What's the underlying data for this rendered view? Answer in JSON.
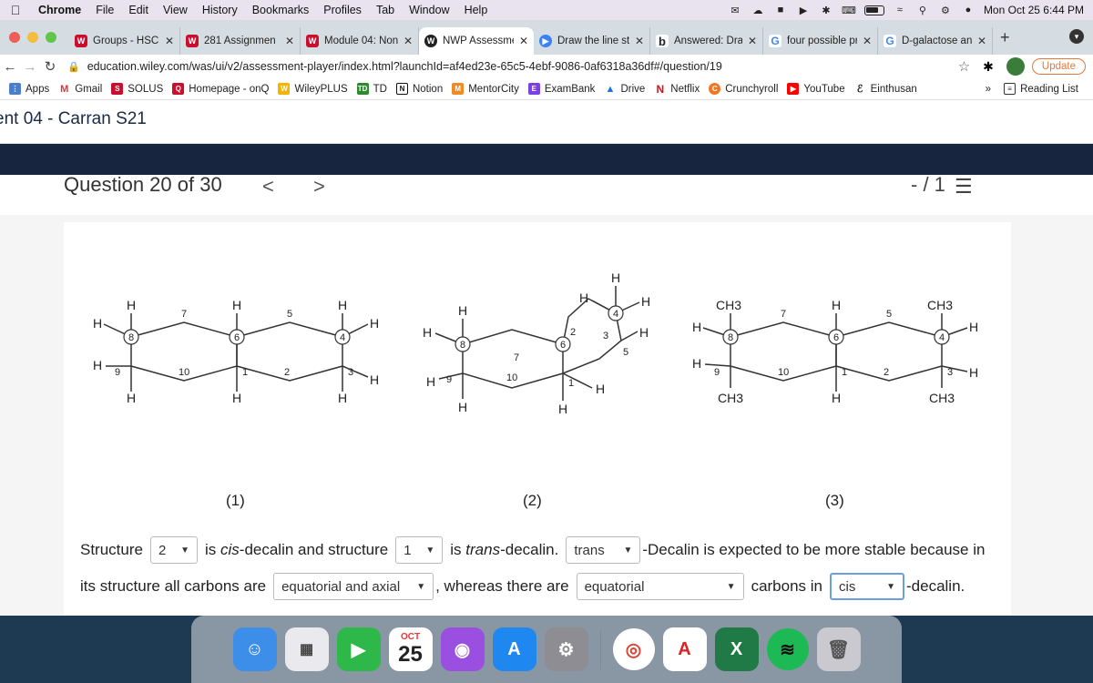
{
  "menubar": {
    "app": "Chrome",
    "items": [
      "File",
      "Edit",
      "View",
      "History",
      "Bookmarks",
      "Profiles",
      "Tab",
      "Window",
      "Help"
    ],
    "clock": "Mon Oct 25  6:44 PM"
  },
  "tabs": [
    {
      "label": "Groups - HSCI",
      "icon": "wiley"
    },
    {
      "label": "281 Assignmen",
      "icon": "wiley"
    },
    {
      "label": "Module 04: Non",
      "icon": "wiley"
    },
    {
      "label": "NWP Assessme",
      "icon": "wiley-active"
    },
    {
      "label": "Draw the line st",
      "icon": "media"
    },
    {
      "label": "Answered: Draw",
      "icon": "bartleby"
    },
    {
      "label": "four possible pr",
      "icon": "google"
    },
    {
      "label": "D-galactose an",
      "icon": "google"
    }
  ],
  "toolbar": {
    "url": "education.wiley.com/was/ui/v2/assessment-player/index.html?launchId=af4ed23e-65c5-4ebf-9086-0af6318a36df#/question/19",
    "update_label": "Update"
  },
  "bookmarks": {
    "items": [
      "Apps",
      "Gmail",
      "SOLUS",
      "Homepage - onQ",
      "WileyPLUS",
      "TD",
      "Notion",
      "MentorCity",
      "ExamBank",
      "Drive",
      "Netflix",
      "Crunchyroll",
      "YouTube",
      "Einthusan"
    ],
    "more": "»",
    "reading_list": "Reading List"
  },
  "site": {
    "title": "ent 04 - Carran S21"
  },
  "question": {
    "label": "Question 20 of 30",
    "prev": "<",
    "next": ">",
    "score": "- / 1"
  },
  "structures": {
    "labels": [
      "(1)",
      "(2)",
      "(3)"
    ],
    "H": "H",
    "CH3": "CH3",
    "s1_numbers": [
      "8",
      "7",
      "6",
      "5",
      "4",
      "9",
      "10",
      "1",
      "2",
      "3"
    ],
    "s2_numbers": [
      "4",
      "3",
      "2",
      "7",
      "5",
      "8",
      "6",
      "9",
      "10",
      "1"
    ],
    "s3_numbers": [
      "8",
      "7",
      "6",
      "5",
      "4",
      "9",
      "10",
      "1",
      "2",
      "3"
    ]
  },
  "answers": {
    "t1": "Structure",
    "sel1": "2",
    "t2": "is",
    "t2_em": "cis",
    "t2b": "-decalin and structure",
    "sel2": "1",
    "t3": "is",
    "t3_em": "trans",
    "t3b": "-decalin.",
    "sel3": "trans",
    "t4": "-Decalin is expected to be more stable because in",
    "t5": "its structure all carbons are",
    "sel4": "equatorial and axial",
    "t6": ", whereas there are",
    "sel5": "equatorial",
    "t7": "carbons in",
    "sel6": "cis",
    "t8": "-decalin."
  },
  "dock": {
    "calendar_month": "OCT",
    "calendar_day": "25"
  }
}
